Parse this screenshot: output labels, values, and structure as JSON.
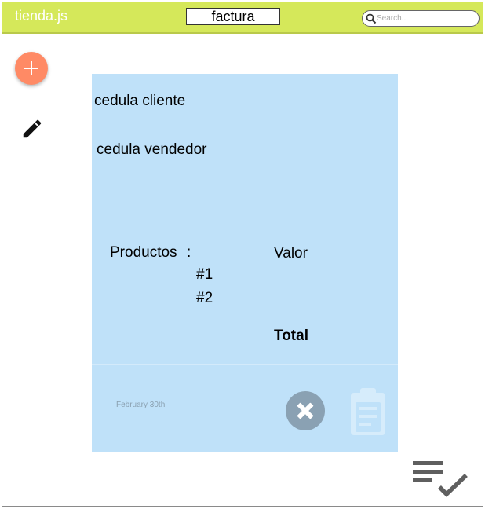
{
  "app": {
    "title": "tienda.js"
  },
  "header": {
    "page_title": "factura"
  },
  "search": {
    "placeholder": "Search...",
    "value": ""
  },
  "sidebar": {
    "add_icon": "plus-icon",
    "edit_icon": "pencil-icon"
  },
  "invoice": {
    "cedula_cliente": "cedula cliente",
    "cedula_vendedor": "cedula vendedor",
    "productos_label": "Productos",
    "colon": ":",
    "valor_label": "Valor",
    "items": [
      "#1",
      "#2"
    ],
    "total_label": "Total",
    "date": "February 30th",
    "close_icon": "close-circle-icon",
    "clipboard_icon": "clipboard-icon"
  },
  "footer": {
    "done_icon": "checklist-icon"
  },
  "colors": {
    "topbar": "#d5e85a",
    "fab": "#ff8a65",
    "card": "#bfe1f9",
    "close_button": "#8aa1b3"
  }
}
